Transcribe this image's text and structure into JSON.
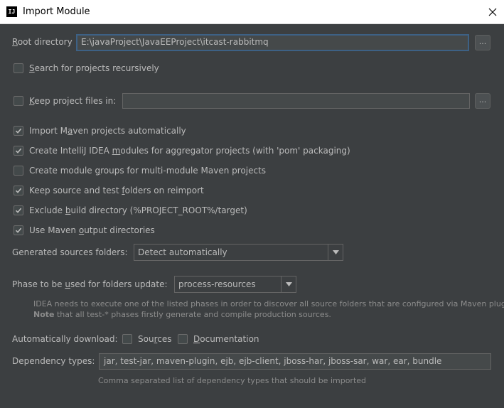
{
  "window": {
    "title": "Import Module",
    "logo_text": "IJ"
  },
  "root_directory": {
    "label_pre": "",
    "label_mn": "R",
    "label_post": "oot directory",
    "value": "E:\\javaProject\\JavaEEProject\\itcast-rabbitmq",
    "browse_label": "..."
  },
  "search_recursively": {
    "pre": "",
    "mn": "S",
    "post": "earch for projects recursively",
    "checked": false
  },
  "keep_project_files": {
    "pre": "",
    "mn": "K",
    "post": "eep project files in:",
    "checked": false,
    "value": "",
    "browse_label": "..."
  },
  "options": [
    {
      "pre": "Import M",
      "mn": "a",
      "post": "ven projects automatically",
      "checked": true
    },
    {
      "pre": "Create IntelliJ IDEA ",
      "mn": "m",
      "post": "odules for aggregator projects (with 'pom' packaging)",
      "checked": true
    },
    {
      "pre": "Create module ",
      "mn": "g",
      "post": "roups for multi-module Maven projects",
      "checked": false
    },
    {
      "pre": "Keep source and test ",
      "mn": "f",
      "post": "olders on reimport",
      "checked": true
    },
    {
      "pre": "Exclude ",
      "mn": "b",
      "post": "uild directory (%PROJECT_ROOT%/target)",
      "checked": true
    },
    {
      "pre": "Use Maven ",
      "mn": "o",
      "post": "utput directories",
      "checked": true
    }
  ],
  "generated_sources": {
    "label": "Generated sources folders:",
    "value": "Detect automatically"
  },
  "phase": {
    "label_pre": "Phase to be ",
    "label_mn": "u",
    "label_post": "sed for folders update:",
    "value": "process-resources",
    "hint_line1": "IDEA needs to execute one of the listed phases in order to discover all source folders that are configured via Maven plugins.",
    "hint_bold": "Note",
    "hint_line2": " that all test-* phases firstly generate and compile production sources."
  },
  "auto_download": {
    "label": "Automatically download:",
    "sources": {
      "pre": "Sou",
      "mn": "r",
      "post": "ces",
      "checked": false
    },
    "documentation": {
      "pre": "",
      "mn": "D",
      "post": "ocumentation",
      "checked": false
    }
  },
  "dependency_types": {
    "label": "Dependency types:",
    "value": "jar, test-jar, maven-plugin, ejb, ejb-client, jboss-har, jboss-sar, war, ear, bundle",
    "hint": "Comma separated list of dependency types that should be imported"
  },
  "colors": {
    "background": "#3c3f41",
    "focus_border": "#3d6185",
    "text": "#bbbbbb"
  }
}
